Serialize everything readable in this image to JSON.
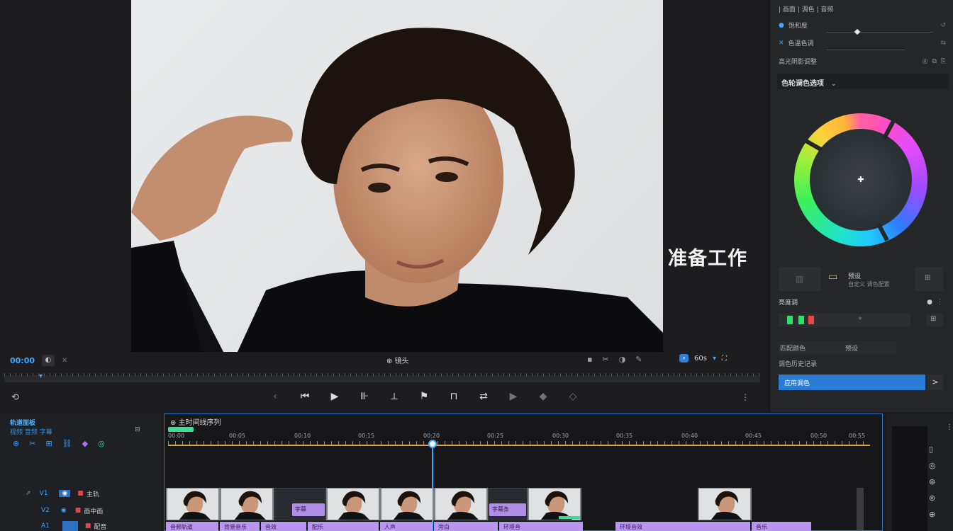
{
  "viewer": {
    "overlay_title": "准备工作",
    "timecode_left": "00:00",
    "clip_name": "⊕ 镜头",
    "zoom_label": "60s",
    "zoom_unit": "s",
    "center_bar_label": "⊕ 镜头"
  },
  "inspector": {
    "top_label": "| 画面 | 调色 | 音频",
    "row1_label": "饱和度",
    "row2_label": "色温色调",
    "row3_label": "高光阴影调整",
    "section_title": "色轮调色选项",
    "swatch_label": "预设",
    "swatch_sub": "自定义 调色配置",
    "row4_label": "亮度调",
    "row5_label": "匹配颜色",
    "row5_value": "预设",
    "row6_label": "调色历史记录",
    "apply_label": "应用调色",
    "apply_next": ">"
  },
  "tracks_panel": {
    "title": "轨道面板",
    "subtitle": "视频 音频 字幕",
    "track1_label": "V1",
    "track1_name": "主轨",
    "track2_label": "V2",
    "track2_name": "画中画",
    "track3_label": "A1",
    "track3_name": "配音"
  },
  "timeline": {
    "title": "⊕ 主时间线序列",
    "ticks": [
      "00:00",
      "00:05",
      "00:10",
      "00:15",
      "00:20",
      "00:25",
      "00:30",
      "00:35",
      "00:40",
      "00:45",
      "00:50",
      "00:55"
    ],
    "label_clips": [
      "字幕",
      "字幕条"
    ],
    "audio_clips": [
      "音频轨道",
      "背景音乐",
      "音效",
      "配乐",
      "人声",
      "旁白",
      "环境音",
      "环境音效",
      "音乐"
    ]
  },
  "colors": {
    "accent_blue": "#2f7fd4",
    "timeline_border": "#2d72c4",
    "playhead": "#3fa7ff",
    "clip_purple": "#b696ef",
    "ruler_gold": "#d9a441",
    "marker_green": "#3ddc97"
  }
}
